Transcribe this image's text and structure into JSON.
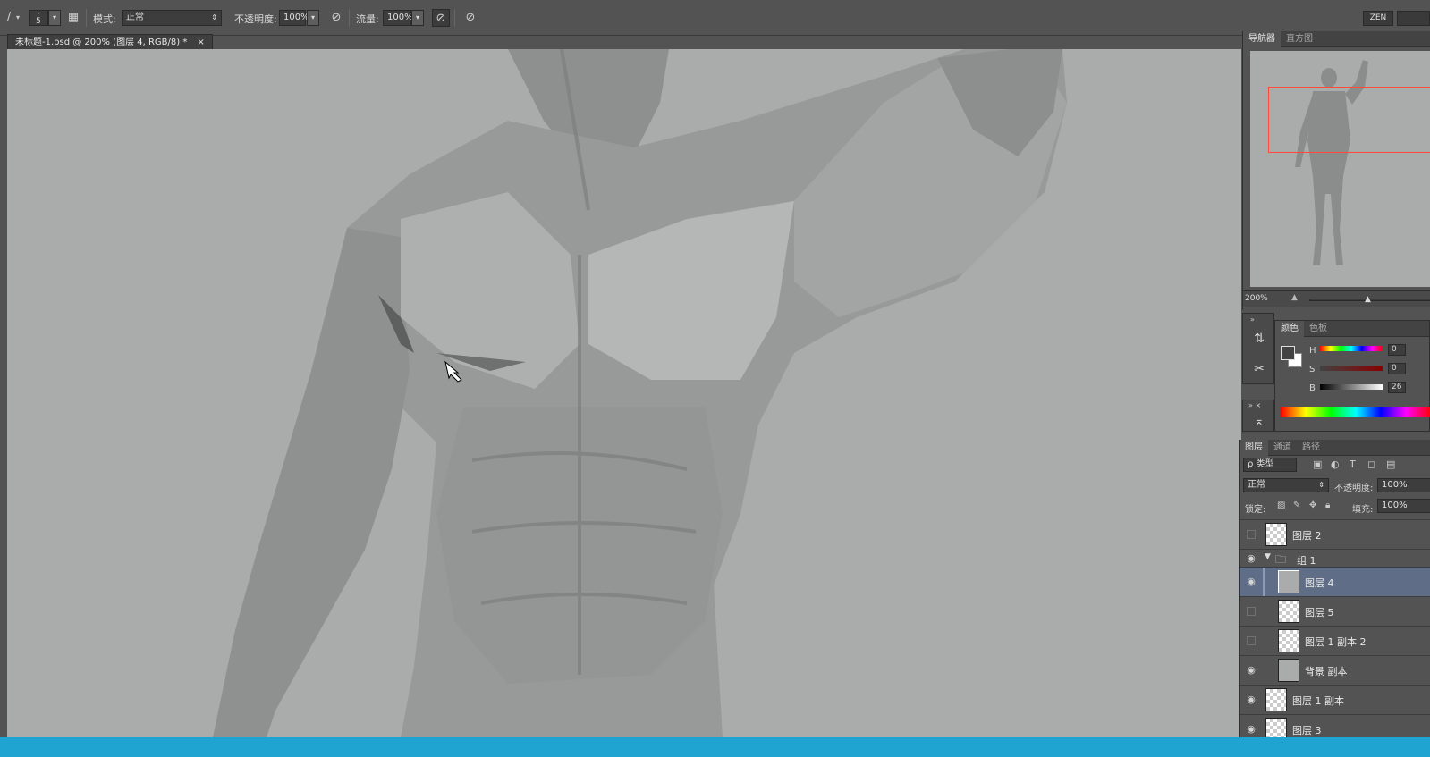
{
  "options_bar": {
    "brush_size": "5",
    "mode_label": "模式:",
    "mode_value": "正常",
    "opacity_label": "不透明度:",
    "opacity_value": "100%",
    "flow_label": "流量:",
    "flow_value": "100%",
    "workspace": "ZEN"
  },
  "document_tab": {
    "title": "未标题-1.psd @ 200% (图层 4, RGB/8) *",
    "close": "×"
  },
  "navigator": {
    "tabs": [
      "导航器",
      "直方图"
    ],
    "zoom": "200%"
  },
  "color_panel": {
    "tabs": [
      "颜色",
      "色板"
    ],
    "channels": [
      {
        "label": "H",
        "value": "0"
      },
      {
        "label": "S",
        "value": "0"
      },
      {
        "label": "B",
        "value": "26"
      }
    ]
  },
  "layers_panel": {
    "tabs": [
      "图层",
      "通道",
      "路径"
    ],
    "filter_label": "ρ 类型",
    "blend_mode": "正常",
    "opacity_label": "不透明度:",
    "opacity_value": "100%",
    "lock_label": "锁定:",
    "fill_label": "填充:",
    "fill_value": "100%",
    "layers": [
      {
        "name": "图层 2",
        "visible": false,
        "indent": false,
        "thumb": "transparent"
      },
      {
        "name": "组 1",
        "visible": true,
        "group": true
      },
      {
        "name": "图层 4",
        "visible": true,
        "indent": true,
        "selected": true,
        "thumb": "figure"
      },
      {
        "name": "图层 5",
        "visible": false,
        "indent": true,
        "thumb": "transparent"
      },
      {
        "name": "图层 1 副本 2",
        "visible": false,
        "indent": true,
        "thumb": "figure"
      },
      {
        "name": "背景 副本",
        "visible": true,
        "indent": true,
        "thumb": "gray"
      },
      {
        "name": "图层 1 副本",
        "visible": true,
        "indent": false,
        "thumb": "figure"
      },
      {
        "name": "图层 3",
        "visible": true,
        "indent": false,
        "thumb": "figure"
      }
    ]
  },
  "colors": {
    "canvas": "#a9acaa",
    "ui_bg": "#535353",
    "selected_layer": "#5f6d86",
    "status_bar": "#1fa3d1",
    "nav_viewbox": "#ff4a3a"
  }
}
